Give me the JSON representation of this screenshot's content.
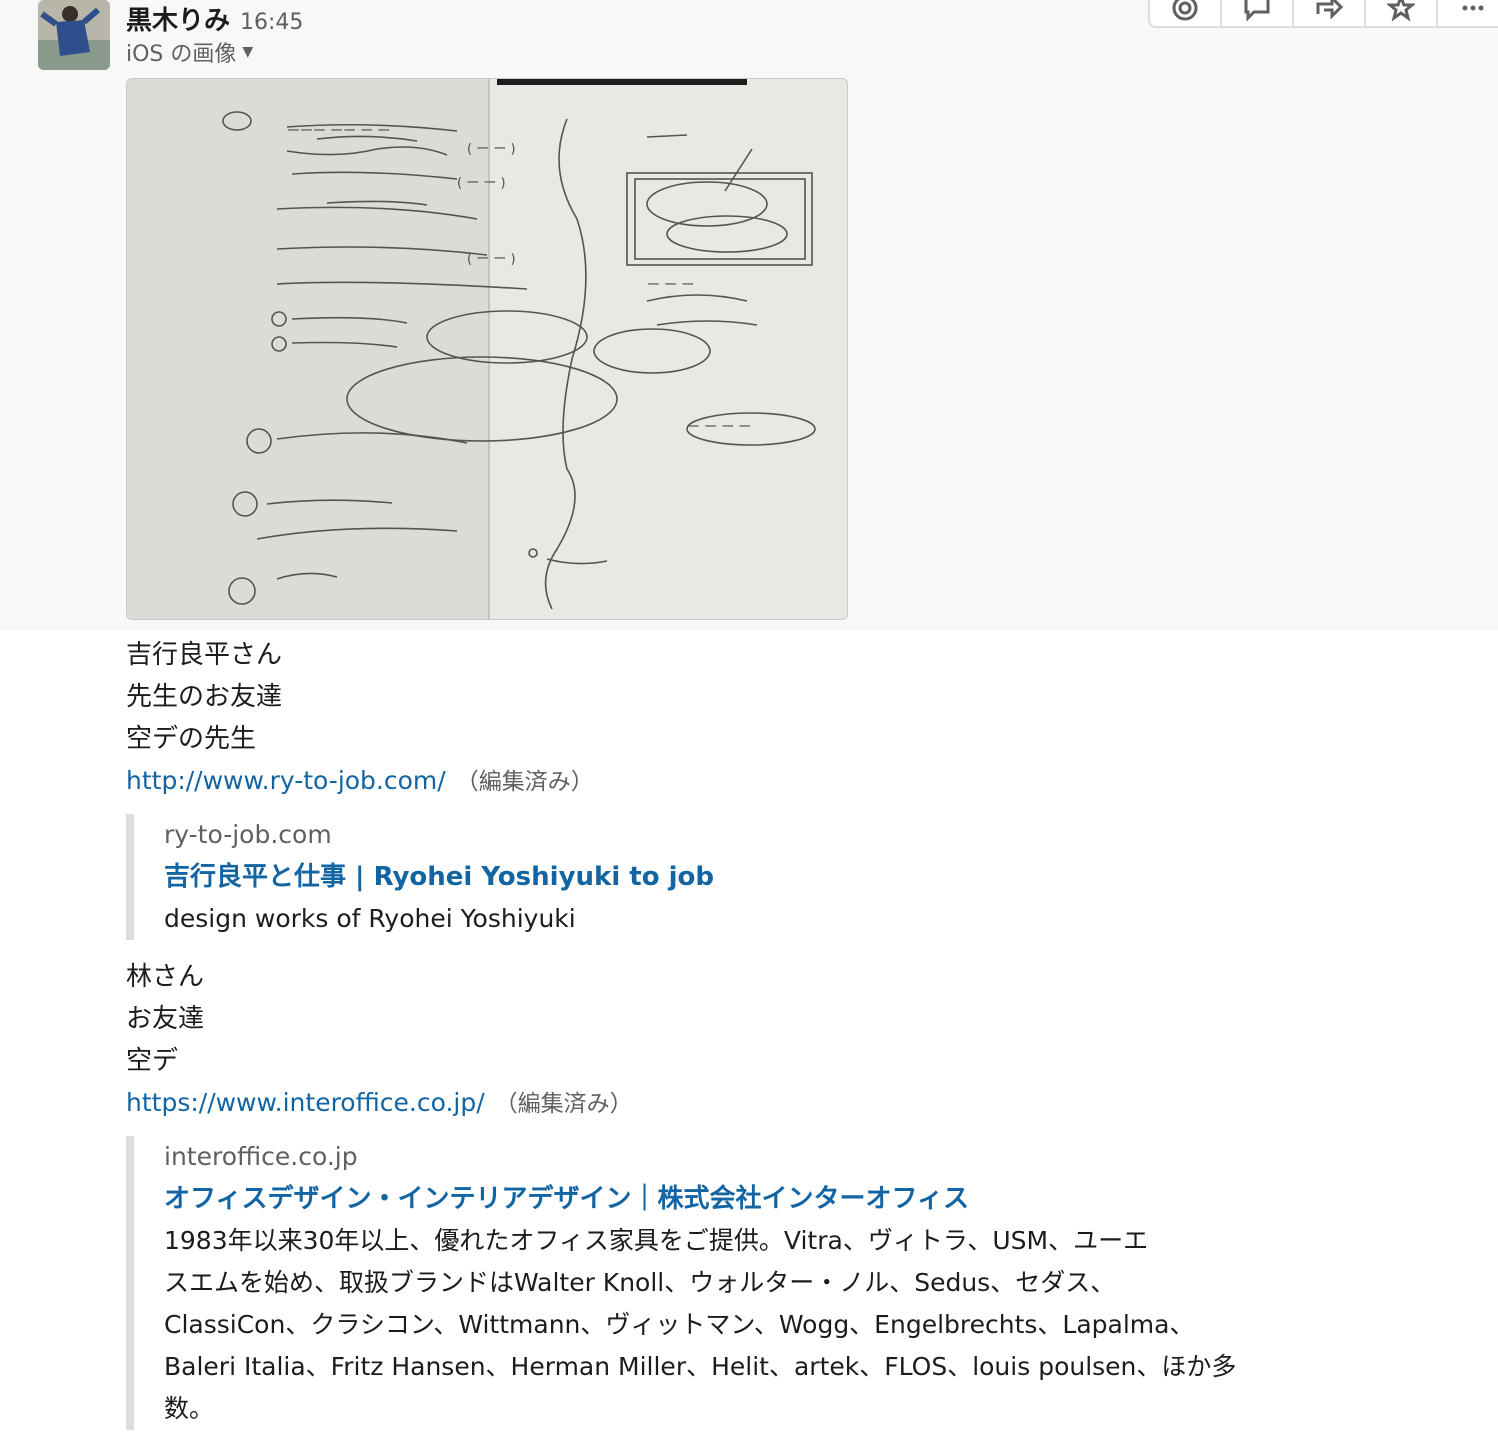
{
  "message": {
    "sender": "黒木りみ",
    "time": "16:45",
    "file_title": "iOS の画像"
  },
  "actions": [
    "emoji-reaction",
    "reply-thread",
    "share-message",
    "save-star",
    "more-actions"
  ],
  "body": {
    "block1": [
      "吉行良平さん",
      "先生のお友達",
      "空デの先生"
    ],
    "link1": "http://www.ry-to-job.com/",
    "edited_label": "（編集済み）",
    "unfurl1": {
      "site": "ry-to-job.com",
      "title": "吉行良平と仕事 | Ryohei Yoshiyuki to job",
      "description": "design works of Ryohei Yoshiyuki"
    },
    "block2": [
      "林さん",
      "お友達",
      "空デ"
    ],
    "link2": "https://www.interoffice.co.jp/",
    "unfurl2": {
      "site": "interoffice.co.jp",
      "title": "オフィスデザイン・インテリアデザイン｜株式会社インターオフィス",
      "description_lines": [
        "1983年以来30年以上、優れたオフィス家具をご提供。Vitra、ヴィトラ、USM、ユーエ",
        "スエムを始め、取扱ブランドはWalter Knoll、ウォルター・ノル、Sedus、セダス、",
        "ClassiCon、クラシコン、Wittmann、ヴィットマン、Wogg、Engelbrechts、Lapalma、",
        "Baleri Italia、Fritz Hansen、Herman Miller、Helit、artek、FLOS、louis poulsen、ほか多",
        "数。"
      ]
    }
  },
  "colors": {
    "link": "#1264a3",
    "muted": "#616061",
    "text": "#1d1c1d",
    "quote_bar": "#dddddd"
  }
}
